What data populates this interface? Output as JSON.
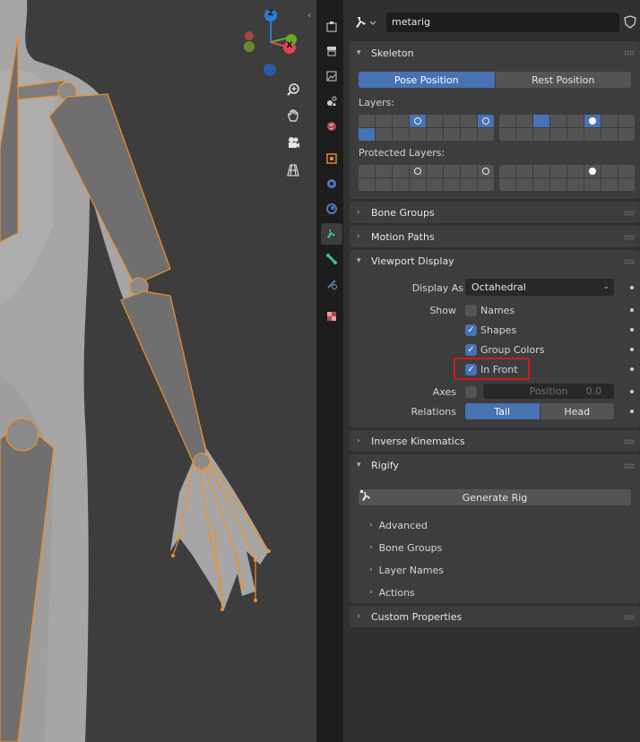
{
  "object_name": "metarig",
  "skeleton": {
    "title": "Skeleton",
    "pose_position": "Pose Position",
    "rest_position": "Rest Position",
    "layers_label": "Layers:",
    "protected_label": "Protected Layers:"
  },
  "collapsed_panels": {
    "bone_groups": "Bone Groups",
    "motion_paths": "Motion Paths",
    "inverse_kinematics": "Inverse Kinematics",
    "custom_properties": "Custom Properties"
  },
  "viewport_display": {
    "title": "Viewport Display",
    "display_as_label": "Display As",
    "display_as_value": "Octahedral",
    "show_label": "Show",
    "names": "Names",
    "shapes": "Shapes",
    "group_colors": "Group Colors",
    "in_front": "In Front",
    "axes_label": "Axes",
    "position_label": "Position",
    "position_value": "0.0",
    "relations_label": "Relations",
    "tail": "Tail",
    "head": "Head"
  },
  "rigify": {
    "title": "Rigify",
    "generate": "Generate Rig",
    "advanced": "Advanced",
    "bone_groups": "Bone Groups",
    "layer_names": "Layer Names",
    "actions": "Actions"
  },
  "gizmo": {
    "z": "Z",
    "x": "X"
  },
  "colors": {
    "accent": "#4772b3",
    "bone": "#f0902a",
    "highlight": "#d11a1a"
  }
}
